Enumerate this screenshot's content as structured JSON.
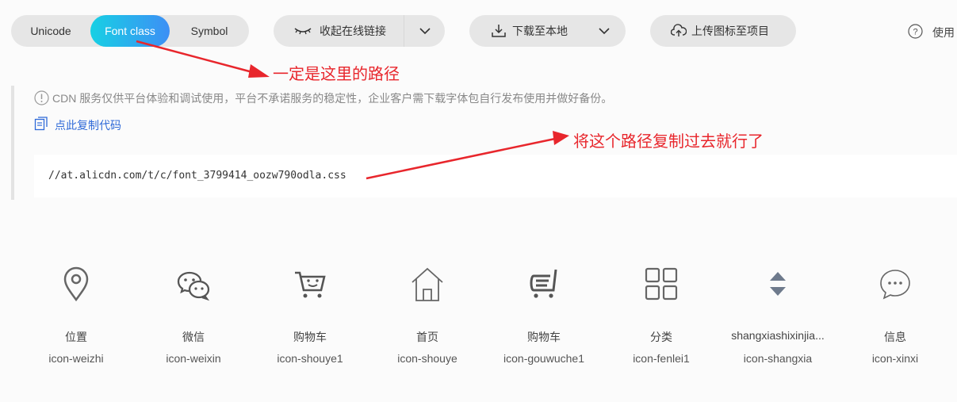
{
  "tabs": [
    {
      "label": "Unicode",
      "active": false
    },
    {
      "label": "Font class",
      "active": true
    },
    {
      "label": "Symbol",
      "active": false
    }
  ],
  "toolbar": {
    "collapse_label": "收起在线链接",
    "download_label": "下载至本地",
    "upload_label": "上传图标至项目",
    "help_label": "使用"
  },
  "online_link": {
    "notice": "CDN 服务仅供平台体验和调试使用，平台不承诺服务的稳定性，企业客户需下载字体包自行发布使用并做好备份。",
    "copy_label": "点此复制代码",
    "css_url": "//at.alicdn.com/t/c/font_3799414_oozw790odla.css"
  },
  "annotations": {
    "path_note": "一定是这里的路径",
    "copy_note": "将这个路径复制过去就行了"
  },
  "icons": [
    {
      "name": "位置",
      "class": "icon-weizhi",
      "glyph": "location-pin-icon"
    },
    {
      "name": "微信",
      "class": "icon-weixin",
      "glyph": "wechat-icon"
    },
    {
      "name": "购物车",
      "class": "icon-shouye1",
      "glyph": "shopping-cart-icon"
    },
    {
      "name": "首页",
      "class": "icon-shouye",
      "glyph": "home-icon"
    },
    {
      "name": "购物车",
      "class": "icon-gouwuche1",
      "glyph": "cart-list-icon"
    },
    {
      "name": "分类",
      "class": "icon-fenlei1",
      "glyph": "grid-category-icon"
    },
    {
      "name": "shangxiashixinjia...",
      "class": "icon-shangxia",
      "glyph": "up-down-triangle-icon"
    },
    {
      "name": "信息",
      "class": "icon-xinxi",
      "glyph": "chat-bubble-icon"
    }
  ],
  "colors": {
    "tab_gradient_start": "#17d0e4",
    "tab_gradient_end": "#3d8ff5",
    "annotation_red": "#e8262c",
    "link_blue": "#2f6ad8",
    "icon_gray": "#666666"
  }
}
